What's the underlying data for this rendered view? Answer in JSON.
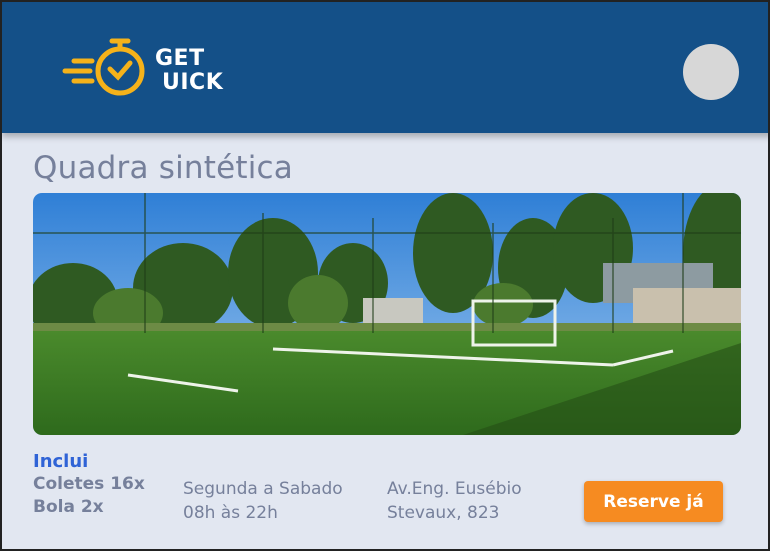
{
  "header": {
    "logo_line1": "GET",
    "logo_line2": "UICK",
    "brand_color": "#145088",
    "logo_color": "#f5b21a"
  },
  "court": {
    "title": "Quadra sintética",
    "includes_title": "Inclui",
    "includes_items": [
      "Coletes 16x",
      "Bola 2x"
    ],
    "schedule_days": "Segunda a Sabado",
    "schedule_hours": "08h às 22h",
    "address_line1": "Av.Eng. Eusébio",
    "address_line2": "Stevaux, 823",
    "reserve_label": "Reserve já",
    "accent_color": "#f68b21"
  }
}
